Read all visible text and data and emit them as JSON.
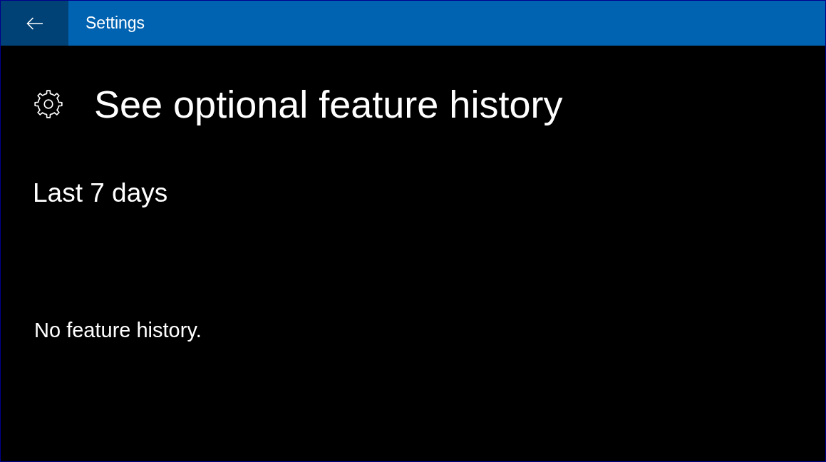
{
  "window": {
    "title": "Settings"
  },
  "page": {
    "title": "See optional feature history"
  },
  "sections": [
    {
      "heading": "Last 7 days",
      "empty_message": "No feature history."
    }
  ]
}
